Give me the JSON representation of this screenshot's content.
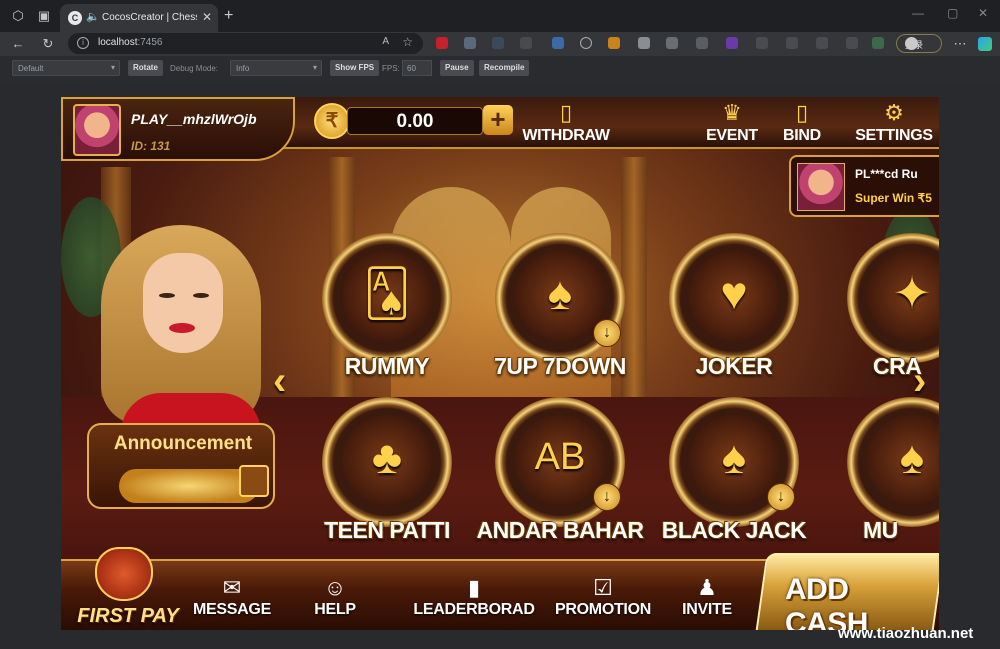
{
  "browser": {
    "tab_title": "CocosCreator | ChessNewE",
    "url_host": "localhost",
    "url_port": ":7456",
    "login_label": "登录",
    "read_aloud": "A",
    "new_tab": "+",
    "tab_close": "✕"
  },
  "cocos_toolbar": {
    "device_select": "Default",
    "rotate_label": "Rotate",
    "debug_mode_label": "Debug Mode:",
    "debug_mode_value": "Info",
    "show_fps_label": "Show FPS",
    "fps_label": "FPS:",
    "fps_value": "60",
    "pause_label": "Pause",
    "recompile_label": "Recompile"
  },
  "game": {
    "player": {
      "name": "PLAY__mhzlWrOjb",
      "id": "ID: 131"
    },
    "balance": {
      "currency_symbol": "₹",
      "amount": "0.00",
      "add": "+"
    },
    "top_nav": [
      {
        "label": "WITHDRAW",
        "icon": "withdraw-icon",
        "glyph": "▯"
      },
      {
        "label": "EVENT",
        "icon": "crown-icon",
        "glyph": "♛"
      },
      {
        "label": "BIND",
        "icon": "phone-icon",
        "glyph": "▯"
      },
      {
        "label": "SETTINGS",
        "icon": "gear-icon",
        "glyph": "⚙"
      }
    ],
    "ticker": {
      "line1": "PL***cd    Ru",
      "line2": "Super Win ₹5"
    },
    "announcement": "Announcement",
    "tiles": [
      {
        "label": "RUMMY",
        "glyph": "🂡",
        "download": false
      },
      {
        "label": "7UP 7DOWN",
        "glyph": "♠",
        "download": true
      },
      {
        "label": "JOKER",
        "glyph": "♥",
        "download": false
      },
      {
        "label": "CRA",
        "glyph": "✦",
        "download": false
      },
      {
        "label": "TEEN PATTI",
        "glyph": "♣",
        "download": false
      },
      {
        "label": "ANDAR BAHAR",
        "glyph": "AB",
        "download": true
      },
      {
        "label": "BLACK JACK",
        "glyph": "♠",
        "download": true
      },
      {
        "label": "MU",
        "glyph": "♠",
        "download": false
      }
    ],
    "arrows": {
      "left": "‹",
      "right": "›"
    },
    "download_glyph": "↓",
    "bottom_nav": [
      {
        "label": "MESSAGE",
        "icon": "envelope-icon",
        "glyph": "✉"
      },
      {
        "label": "HELP",
        "icon": "support-icon",
        "glyph": "☺"
      },
      {
        "label": "LEADERBORAD",
        "icon": "leaderboard-icon",
        "glyph": "▮"
      },
      {
        "label": "PROMOTION",
        "icon": "clipboard-icon",
        "glyph": "☑"
      },
      {
        "label": "INVITE",
        "icon": "invite-icon",
        "glyph": "♟"
      }
    ],
    "first_pay": "FIRST PAY",
    "add_cash": "ADD CASH"
  },
  "watermark": "www.tiaozhuan.net"
}
